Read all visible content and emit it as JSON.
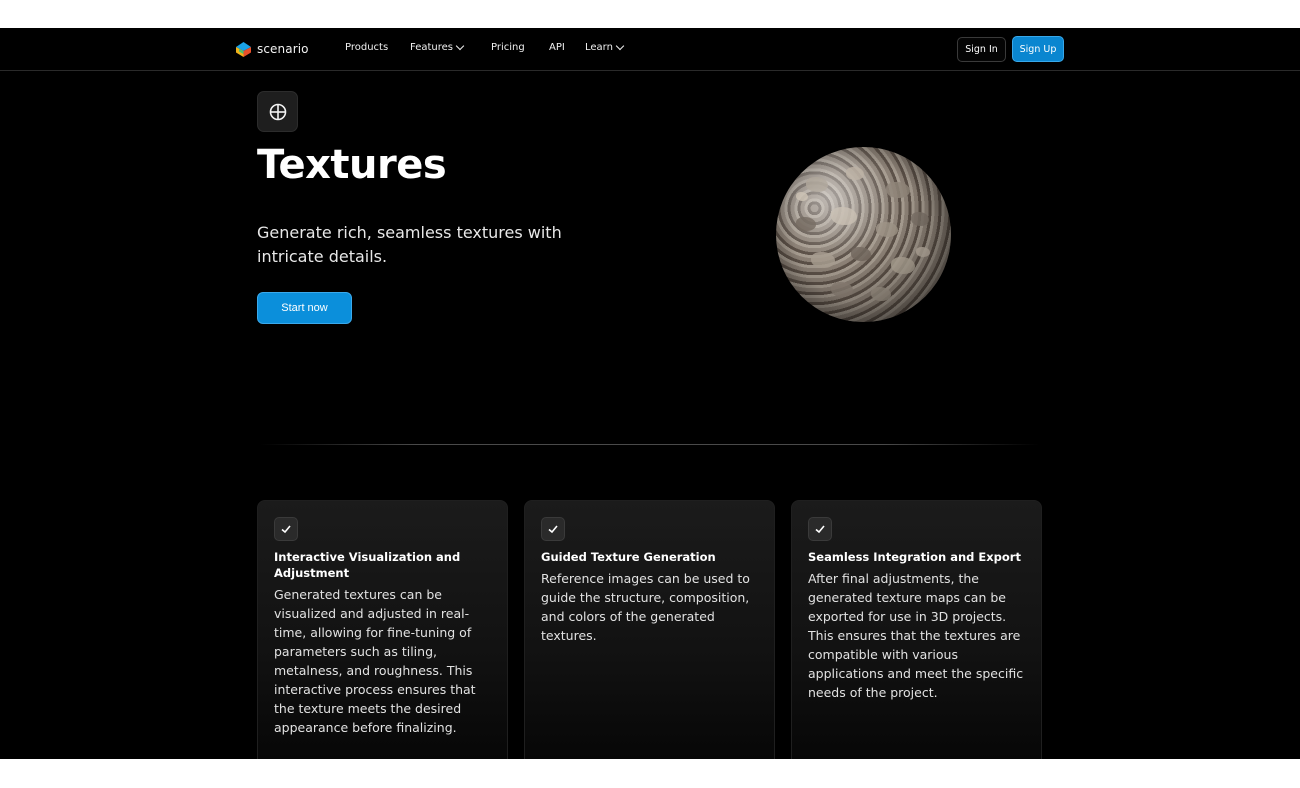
{
  "nav": {
    "logo_text": "scenario",
    "links": [
      {
        "label": "Products",
        "has_dropdown": false
      },
      {
        "label": "Features",
        "has_dropdown": true
      },
      {
        "label": "Pricing",
        "has_dropdown": false
      },
      {
        "label": "API",
        "has_dropdown": false
      },
      {
        "label": "Learn",
        "has_dropdown": true
      }
    ],
    "sign_in": "Sign In",
    "sign_up": "Sign Up"
  },
  "hero": {
    "icon": "crosshair-circle-icon",
    "title": "Textures",
    "subtitle": "Generate rich, seamless textures with intricate details.",
    "cta": "Start now",
    "media": "stone-texture-sphere"
  },
  "features": [
    {
      "icon": "check-icon",
      "title": "Interactive Visualization and Adjustment",
      "body": "Generated textures can be visualized and adjusted in real-time, allowing for fine-tuning of parameters such as tiling, metalness, and roughness. This interactive process ensures that the texture meets the desired appearance before finalizing."
    },
    {
      "icon": "check-icon",
      "title": "Guided Texture Generation",
      "body": "Reference images can be used to guide the structure, composition, and colors of the generated textures."
    },
    {
      "icon": "check-icon",
      "title": "Seamless Integration and Export",
      "body": "After final adjustments, the generated texture maps can be exported for use in 3D projects. This ensures that the textures are compatible with various applications and meet the specific needs of the project."
    }
  ],
  "colors": {
    "accent": "#0b8fdb",
    "background": "#000000",
    "card": "#1b1b1b"
  }
}
